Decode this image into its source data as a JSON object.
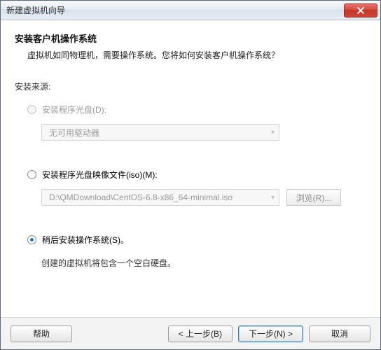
{
  "window": {
    "title": "新建虚拟机向导"
  },
  "header": {
    "heading": "安装客户机操作系统",
    "subheading": "虚拟机如同物理机，需要操作系统。您将如何安装客户机操作系统？"
  },
  "source": {
    "label": "安装来源:",
    "options": {
      "disc": {
        "label": "安装程序光盘(D):",
        "selected": false,
        "enabled": false,
        "dropdown_value": "无可用驱动器"
      },
      "iso": {
        "label": "安装程序光盘映像文件(iso)(M):",
        "selected": false,
        "enabled": true,
        "input_value": "D:\\QMDownload\\CentOS-6.8-x86_64-minimal.iso",
        "browse_label": "浏览(R)..."
      },
      "later": {
        "label": "稍后安装操作系统(S)。",
        "selected": true,
        "hint": "创建的虚拟机将包含一个空白硬盘。"
      }
    }
  },
  "footer": {
    "help": "帮助",
    "back": "< 上一步(B)",
    "next": "下一步(N) >",
    "cancel": "取消"
  }
}
